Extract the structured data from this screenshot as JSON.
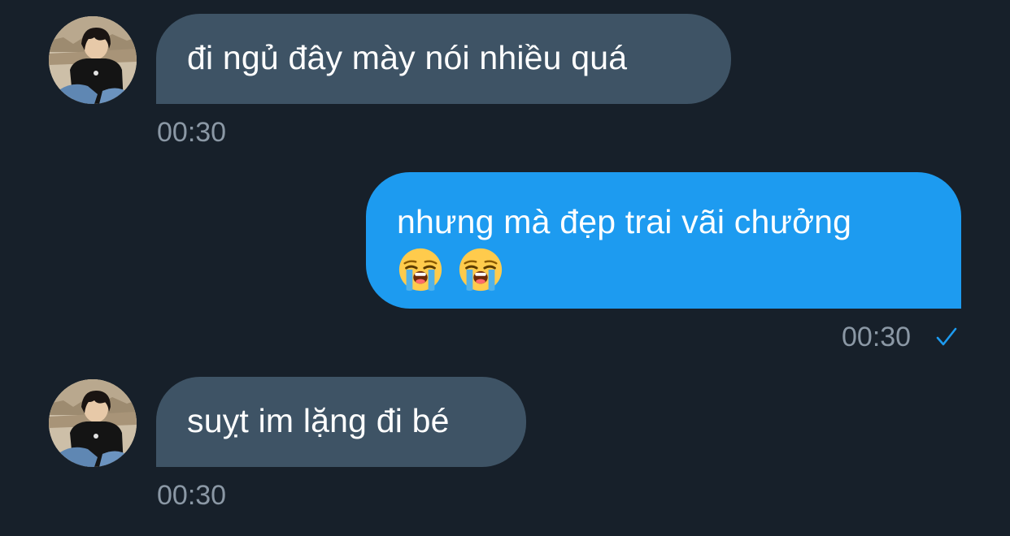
{
  "messages": [
    {
      "direction": "incoming",
      "text": "đi ngủ đây mày nói nhiều quá",
      "time": "00:30"
    },
    {
      "direction": "outgoing",
      "text": "nhưng mà đẹp trai vãi chưởng",
      "emojis": [
        "loudly-crying-face-icon",
        "loudly-crying-face-icon"
      ],
      "time": "00:30",
      "status": "sent"
    },
    {
      "direction": "incoming",
      "text": "suỵt im lặng đi bé",
      "time": "00:30"
    }
  ],
  "colors": {
    "background": "#17202a",
    "incoming_bubble": "#3e5365",
    "outgoing_bubble": "#1d9bf0",
    "timestamp": "#8b98a5",
    "check": "#1d9bf0"
  }
}
